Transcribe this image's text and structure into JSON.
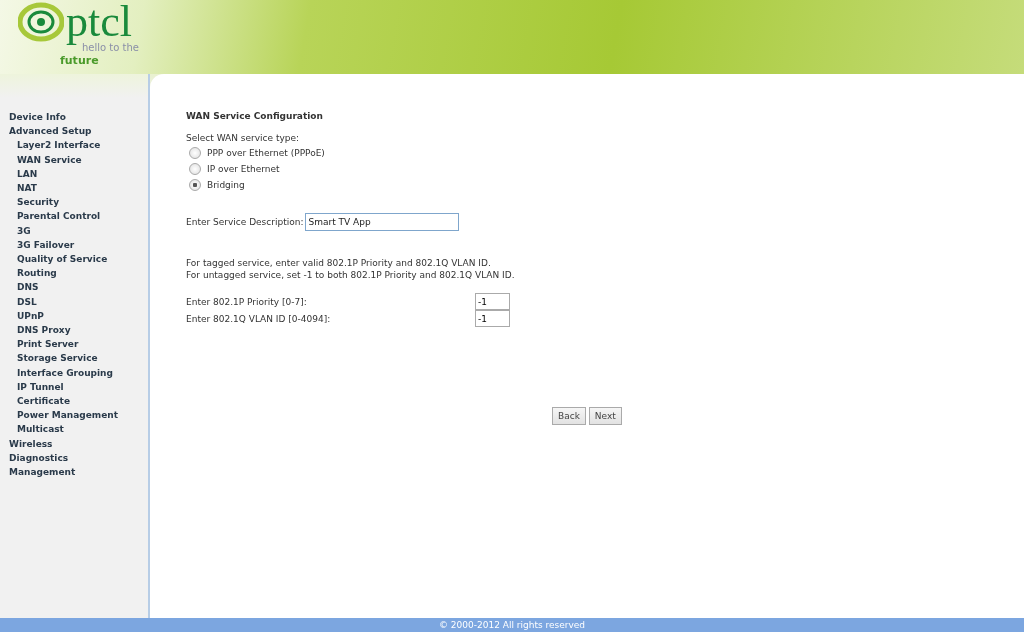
{
  "header": {
    "logo": {
      "brand": "ptcl",
      "tagline_1": "hello to the",
      "tagline_2": "future"
    }
  },
  "sidebar": {
    "items": [
      {
        "label": "Device Info"
      },
      {
        "label": "Advanced Setup",
        "children": [
          {
            "label": "Layer2 Interface"
          },
          {
            "label": "WAN Service"
          },
          {
            "label": "LAN"
          },
          {
            "label": "NAT"
          },
          {
            "label": "Security"
          },
          {
            "label": "Parental Control"
          },
          {
            "label": "3G"
          },
          {
            "label": "3G Failover"
          },
          {
            "label": "Quality of Service"
          },
          {
            "label": "Routing"
          },
          {
            "label": "DNS"
          },
          {
            "label": "DSL"
          },
          {
            "label": "UPnP"
          },
          {
            "label": "DNS Proxy"
          },
          {
            "label": "Print Server"
          },
          {
            "label": "Storage Service"
          },
          {
            "label": "Interface Grouping"
          },
          {
            "label": "IP Tunnel"
          },
          {
            "label": "Certificate"
          },
          {
            "label": "Power Management"
          },
          {
            "label": "Multicast"
          }
        ]
      },
      {
        "label": "Wireless"
      },
      {
        "label": "Diagnostics"
      },
      {
        "label": "Management"
      }
    ]
  },
  "form": {
    "title": "WAN Service Configuration",
    "prompt": "Select WAN service type:",
    "options": [
      {
        "label": "PPP over Ethernet (PPPoE)",
        "selected": false
      },
      {
        "label": "IP over Ethernet",
        "selected": false
      },
      {
        "label": "Bridging",
        "selected": true
      }
    ],
    "description": {
      "label": "Enter Service Description:",
      "value": "Smart TV App"
    },
    "notes": [
      "For tagged service, enter valid 802.1P Priority and 802.1Q VLAN ID.",
      "For untagged service, set -1 to both 802.1P Priority and 802.1Q VLAN ID."
    ],
    "fields": [
      {
        "label": "Enter 802.1P Priority [0-7]:",
        "value": "-1"
      },
      {
        "label": "Enter 802.1Q VLAN ID [0-4094]:",
        "value": "-1"
      }
    ],
    "buttons": [
      "Back",
      "Next"
    ]
  },
  "footer": {
    "text": "© 2000-2012 All rights reserved"
  }
}
